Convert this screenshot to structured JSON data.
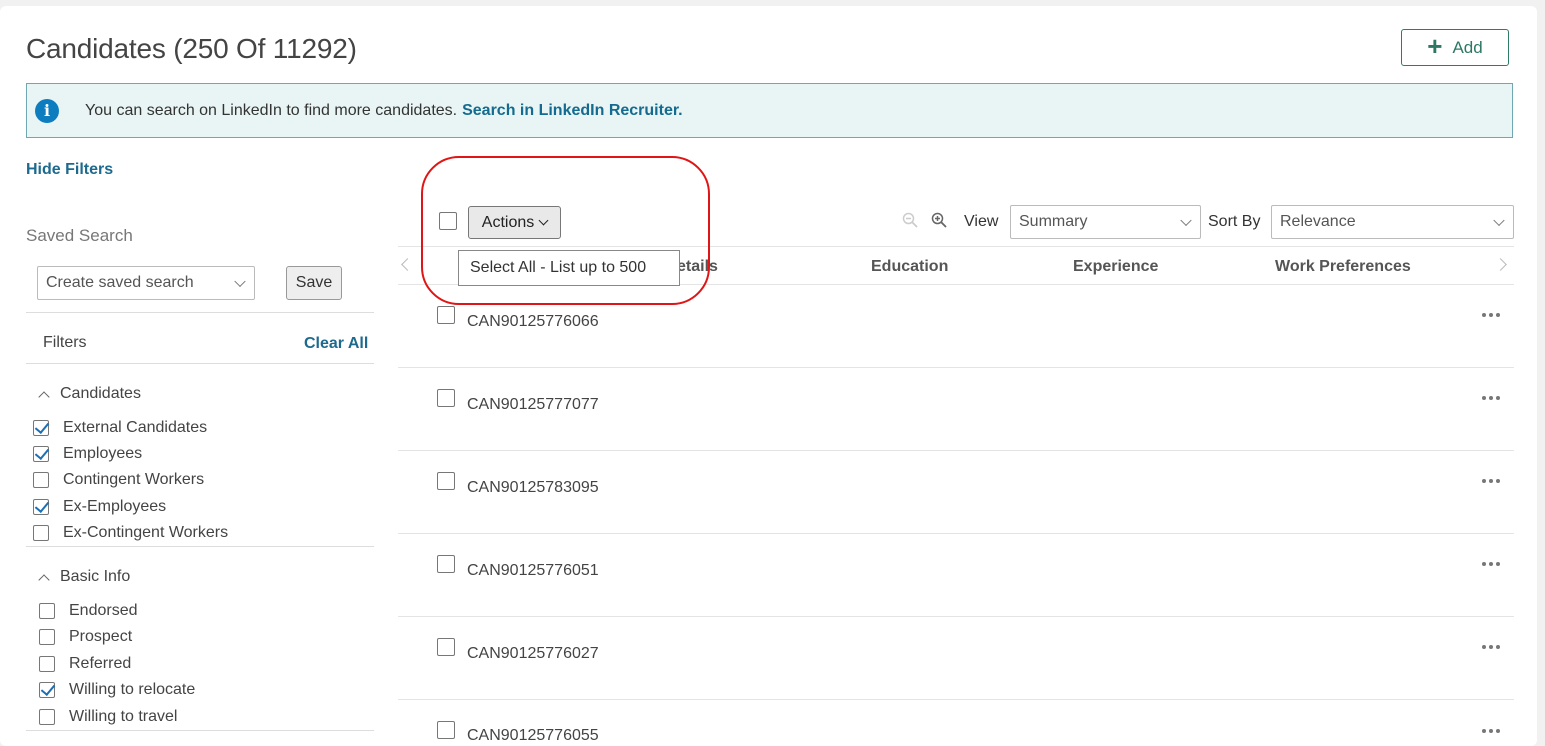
{
  "header": {
    "title": "Candidates (250 Of 11292)",
    "add_label": "Add"
  },
  "banner": {
    "message": "You can search on LinkedIn to find more candidates.",
    "link": "Search in LinkedIn Recruiter."
  },
  "sidebar": {
    "hide_filters": "Hide Filters",
    "saved_search_label": "Saved Search",
    "saved_search_placeholder": "Create saved search",
    "save_label": "Save",
    "filters_label": "Filters",
    "clear_all": "Clear All",
    "groups": [
      {
        "title": "Candidates",
        "items": [
          {
            "label": "External Candidates",
            "checked": true
          },
          {
            "label": "Employees",
            "checked": true
          },
          {
            "label": "Contingent Workers",
            "checked": false
          },
          {
            "label": "Ex-Employees",
            "checked": true
          },
          {
            "label": "Ex-Contingent Workers",
            "checked": false
          }
        ]
      },
      {
        "title": "Basic Info",
        "items": [
          {
            "label": "Endorsed",
            "checked": false
          },
          {
            "label": "Prospect",
            "checked": false
          },
          {
            "label": "Referred",
            "checked": false
          },
          {
            "label": "Willing to relocate",
            "checked": true
          },
          {
            "label": "Willing to travel",
            "checked": false
          }
        ]
      }
    ]
  },
  "toolbar": {
    "actions_label": "Actions",
    "view_label": "View",
    "view_value": "Summary",
    "sort_label": "Sort By",
    "sort_value": "Relevance",
    "tooltip": "Select All - List up to 500"
  },
  "columns": {
    "details_fragment": "etails",
    "education": "Education",
    "experience": "Experience",
    "work_preferences": "Work Preferences"
  },
  "rows": [
    "CAN90125776066",
    "CAN90125777077",
    "CAN90125783095",
    "CAN90125776051",
    "CAN90125776027",
    "CAN90125776055"
  ],
  "colors": {
    "accent": "#1d6a8f",
    "add_green": "#2d7864",
    "banner_bg": "#e8f5f4",
    "annotation_red": "#e01515"
  }
}
